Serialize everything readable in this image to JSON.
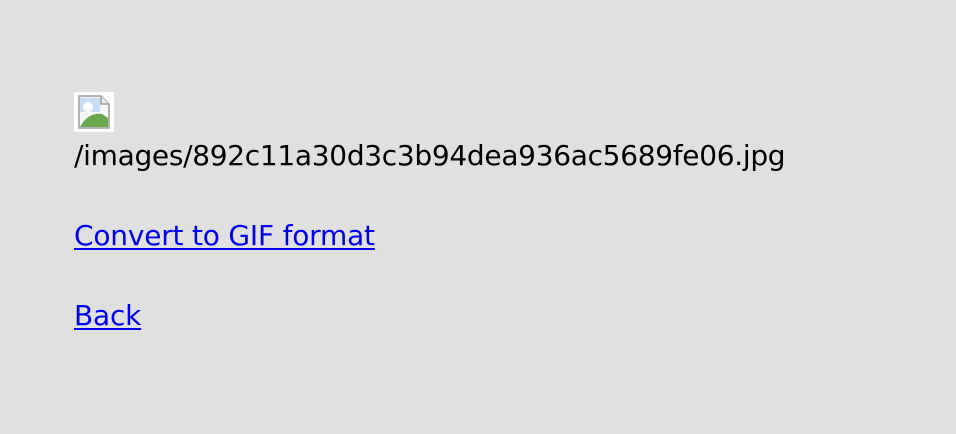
{
  "image": {
    "icon": "broken-image-icon",
    "path": "/images/892c11a30d3c3b94dea936ac5689fe06.jpg"
  },
  "links": {
    "convert_label": "Convert to GIF format",
    "back_label": "Back"
  },
  "colors": {
    "background": "#e0e0e0",
    "link": "#0000ee",
    "text": "#000000"
  }
}
